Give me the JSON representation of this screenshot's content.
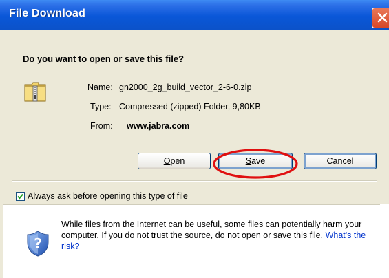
{
  "window": {
    "title": "File Download"
  },
  "prompt": {
    "question": "Do you want to open or save this file?"
  },
  "file": {
    "name_label": "Name:",
    "name_value": "gn2000_2g_build_vector_2-6-0.zip",
    "type_label": "Type:",
    "type_value": "Compressed (zipped) Folder, 9,80KB",
    "from_label": "From:",
    "from_value": "www.jabra.com",
    "icon": "zip-folder-icon"
  },
  "buttons": {
    "open": {
      "label": "Open",
      "mnemonic": "O",
      "rest": "pen"
    },
    "save": {
      "label": "Save",
      "mnemonic": "S",
      "rest": "ave"
    },
    "cancel": {
      "label": "Cancel"
    }
  },
  "checkbox": {
    "checked": true,
    "label_prefix": "Al",
    "label_mnemonic": "w",
    "label_rest": "ays ask before opening this type of file"
  },
  "info": {
    "text": "While files from the Internet can be useful, some files can potentially harm your computer. If you do not trust the source, do not open or save this file.",
    "link": "What's the risk?",
    "icon": "security-shield-icon"
  },
  "annotation": {
    "color": "#E01010",
    "target": "save-button"
  },
  "colors": {
    "titlebar": "#0A57D8",
    "dialog_bg": "#ECE9D8",
    "button_border": "#003C74",
    "link": "#0033CC"
  }
}
